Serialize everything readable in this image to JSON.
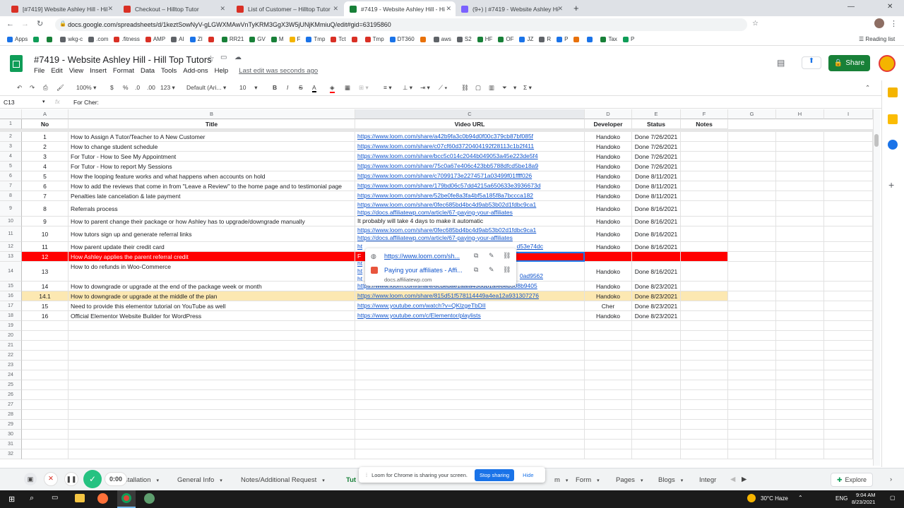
{
  "browser": {
    "tabs": [
      {
        "title": "[#7419] Website Ashley Hill - Hil",
        "color": "#d93025",
        "active": false
      },
      {
        "title": "Checkout – Hilltop Tutor",
        "color": "#d93025",
        "active": false
      },
      {
        "title": "List of Customer – Hilltop Tutor",
        "color": "#d93025",
        "active": false
      },
      {
        "title": "#7419 - Website Ashley Hill - Hi",
        "color": "#188038",
        "active": true
      },
      {
        "title": "(9+) | #7419 - Website Ashley Hi",
        "color": "#7b61ff",
        "active": false
      }
    ],
    "url": "docs.google.com/spreadsheets/d/1keztSowNyV-gLGWXMAwVnTyKRM3GgX3W5jUNjKMmiuQ/edit#gid=63195860",
    "bookmarks": [
      "Apps",
      "",
      "",
      "wkg-c",
      ".com",
      ".fitness",
      "AMP",
      "AI",
      "ZI",
      "",
      "RR21",
      "GV",
      "M",
      "F",
      "Tmp",
      "Tct",
      "",
      "Tmp",
      "DT360",
      "",
      "aws",
      "S2",
      "HF",
      "OF",
      "JZ",
      "R",
      "P",
      "",
      "",
      "Tax",
      "P"
    ],
    "reading_list": "Reading list"
  },
  "doc": {
    "title": "#7419 - Website Ashley Hill - Hill Top Tutors",
    "menus": [
      "File",
      "Edit",
      "View",
      "Insert",
      "Format",
      "Data",
      "Tools",
      "Add-ons",
      "Help"
    ],
    "last_edit": "Last edit was seconds ago",
    "share_label": "Share"
  },
  "toolbar": {
    "zoom": "100%",
    "currency": "$",
    "percent": "%",
    "dec1": ".0",
    "dec2": ".00",
    "format": "123",
    "font": "Default (Ari...",
    "size": "10"
  },
  "formula_bar": {
    "cell_ref": "C13",
    "fx": "fx",
    "content": "For Cher:"
  },
  "grid": {
    "col_letters": [
      "A",
      "B",
      "C",
      "D",
      "E",
      "F",
      "G",
      "H",
      "I"
    ],
    "headers": [
      "No",
      "Title",
      "Video URL",
      "Developer",
      "Status",
      "Notes"
    ],
    "rows": [
      {
        "r": "2",
        "no": "1",
        "title": "How to Assign A Tutor/Teacher to A New Customer",
        "url": "https://www.loom.com/share/a42b9fa3c0b94d0f00c379cb87bf085f",
        "url2": "",
        "dev": "Handoko",
        "status": "Done 7/26/2021"
      },
      {
        "r": "3",
        "no": "2",
        "title": "How to change student schedule",
        "url": "https://www.loom.com/share/c07cf60d3720404192f28113c1b2f411",
        "url2": "",
        "dev": "Handoko",
        "status": "Done 7/26/2021"
      },
      {
        "r": "4",
        "no": "3",
        "title": "For Tutor - How to See My Appointment",
        "url": "https://www.loom.com/share/bcc5c014c2044b049053a45e223de5f4",
        "url2": "",
        "dev": "Handoko",
        "status": "Done 7/26/2021"
      },
      {
        "r": "5",
        "no": "4",
        "title": "For Tutor - How to report My Sessions",
        "url": "https://www.loom.com/share/75c0a67e406c423bb5788dfcd5be18a9",
        "url2": "",
        "dev": "Handoko",
        "status": "Done 7/26/2021"
      },
      {
        "r": "6",
        "no": "5",
        "title": "How the looping feature works and what happens when accounts on hold",
        "url": "https://www.loom.com/share/c7099173e2274571a03499f01ffff026",
        "url2": "",
        "dev": "Handoko",
        "status": "Done 8/11/2021"
      },
      {
        "r": "7",
        "no": "6",
        "title": "How to add the reviews that come in from \"Leave a Review\" to the home page and to testimonial page",
        "url": "https://www.loom.com/share/179bd06c57dd4215a650633e3936673d",
        "url2": "",
        "dev": "Handoko",
        "status": "Done 8/11/2021"
      },
      {
        "r": "8",
        "no": "7",
        "title": "Penalties late cancelation & late payment",
        "url": "https://www.loom.com/share/52be0fe8a3fa4bf5a185f8a7bccca182",
        "url2": "",
        "dev": "Handoko",
        "status": "Done 8/11/2021"
      },
      {
        "r": "9",
        "no": "8",
        "title": "Referrals process",
        "url": "https://www.loom.com/share/0fec685bd4bc4d9ab53b02d1fdbc9ca1",
        "url2": "https://docs.affiliatewp.com/article/67-paying-your-affiliates",
        "dev": "Handoko",
        "status": "Done 8/16/2021"
      },
      {
        "r": "10",
        "no": "9",
        "title": "How to parent change their package or how Ashley has to upgrade/downgrade manually",
        "url": "It probably will take 4 days to make it automatic",
        "url2": "",
        "dev": "Handoko",
        "status": "Done 8/16/2021",
        "plain": true
      },
      {
        "r": "11",
        "no": "10",
        "title": "How tutors sign up and generate referral links",
        "url": "https://www.loom.com/share/0fec685bd4bc4d9ab53b02d1fdbc9ca1",
        "url2": "https://docs.affiliatewp.com/article/67-paying-your-affiliates",
        "dev": "Handoko",
        "status": "Done 8/16/2021"
      },
      {
        "r": "12",
        "no": "11",
        "title": "How parent update their credit card",
        "url": "ht",
        "url2": "",
        "urlEnd": "d53e74dc",
        "dev": "Handoko",
        "status": "Done 8/16/2021"
      },
      {
        "r": "13",
        "no": "12",
        "title": "How Ashley applies the parent referral credit",
        "url": "F",
        "url2": "",
        "dev": "",
        "status": "",
        "red": true
      },
      {
        "r": "14",
        "no": "13",
        "title": "How to do refunds in Woo-Commerce",
        "url": "ht",
        "url2": "ht",
        "url3": "ht",
        "urlEnd": "0ad9562",
        "dev": "Handoko",
        "status": "Done 8/16/2021"
      },
      {
        "r": "15",
        "no": "14",
        "title": "How to downgrade or upgrade at the end of the package week or month",
        "url": "https://www.loom.com/share/8cdebae1aafa436db1afe8eb308b9405",
        "url2": "",
        "dev": "Handoko",
        "status": "Done 8/23/2021"
      },
      {
        "r": "16",
        "no": "14.1",
        "title": "How to downgrade or upgrade at the middle of the plan",
        "url": "https://www.loom.com/share/815d51f578114449a4ea12a931307276",
        "url2": "",
        "dev": "Handoko",
        "status": "Done 8/23/2021",
        "yellow": true
      },
      {
        "r": "17",
        "no": "15",
        "title": "Need to provide this elementor tutorial on YouTube as well",
        "url": "https://www.youtube.com/watch?v=QKlzgeTbDII",
        "url2": "",
        "dev": "Cher",
        "status": "Done 8/23/2021"
      },
      {
        "r": "18",
        "no": "16",
        "title": "Official Elementor Website Builder for WordPress",
        "url": "https://www.youtube.com/c/Elementor/playlists",
        "url2": "",
        "dev": "Handoko",
        "status": "Done 8/23/2021"
      }
    ],
    "empty_rows": [
      "19",
      "20",
      "21",
      "22",
      "23",
      "24",
      "25",
      "26",
      "27",
      "28",
      "29",
      "30",
      "31",
      "32"
    ]
  },
  "link_popup": {
    "link1": "https://www.loom.com/sh...",
    "link2": "Paying your affiliates - Affi...",
    "link2_domain": "docs.affiliatewp.com"
  },
  "sheets": {
    "tabs": [
      "stallation",
      "General Info",
      "Notes/Additional Request",
      "Tut",
      "m",
      "Form",
      "Pages",
      "Blogs",
      "Integr"
    ],
    "explore": "Explore"
  },
  "loom": {
    "message": "Loom for Chrome is sharing your screen.",
    "stop": "Stop sharing",
    "hide": "Hide",
    "timer": "0:00"
  },
  "taskbar": {
    "weather": "30°C  Haze",
    "lang": "ENG",
    "time": "9:04 AM",
    "date": "8/23/2021"
  }
}
